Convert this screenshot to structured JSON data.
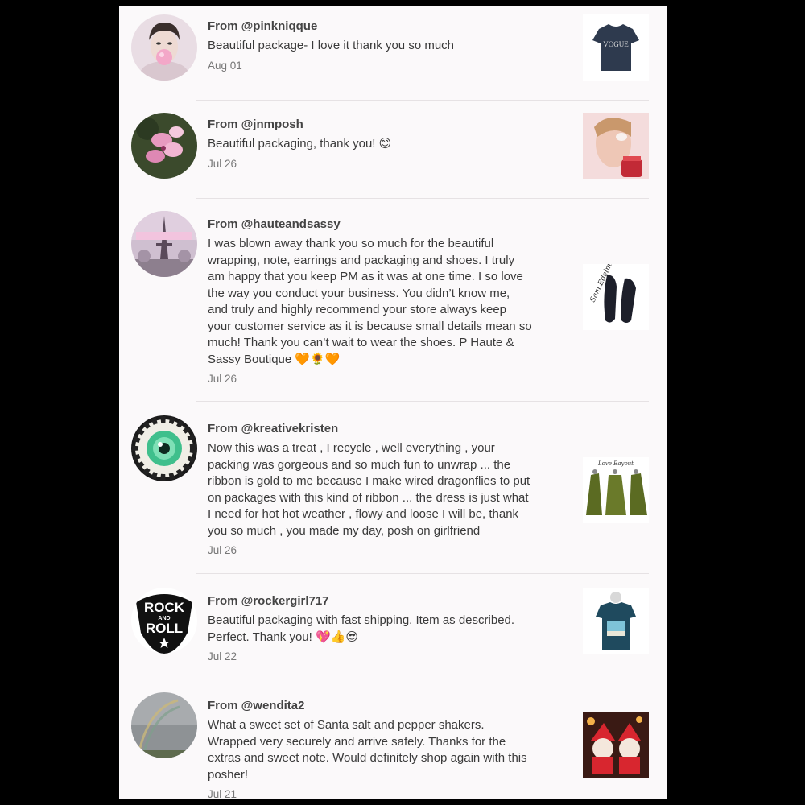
{
  "reviews": [
    {
      "from_prefix": "From",
      "username": "@pinkniqque",
      "message": "Beautiful package- I love it thank you so much",
      "date": "Aug 01",
      "avatar_icon": "avatar-woman-bubblegum",
      "item_icon": "tshirt-vogue"
    },
    {
      "from_prefix": "From",
      "username": "@jnmposh",
      "message": "Beautiful packaging, thank you! 😊",
      "date": "Jul 26",
      "avatar_icon": "avatar-pink-flowers",
      "item_icon": "skincare-model"
    },
    {
      "from_prefix": "From",
      "username": "@hauteandsassy",
      "message": "I was blown away thank you so much for the beautiful\nwrapping, note, earrings and packaging and shoes. I truly\nam happy that you keep PM as it was at one time. I so love\nthe way you conduct your business. You didn’t know me,\nand truly and highly recommend your store always keep\nyour customer service as it is because small details mean so\nmuch! Thank you can’t wait to wear the shoes. P Haute &\nSassy Boutique 🧡🌻🧡",
      "date": "Jul 26",
      "avatar_icon": "avatar-paris-eiffel",
      "item_icon": "black-pumps"
    },
    {
      "from_prefix": "From",
      "username": "@kreativekristen",
      "message": "Now this was a treat , I recycle , well everything , your\npacking was gorgeous and so much fun to unwrap ... the\nribbon is gold to me because I make wired dragonflies to put\non packages with this kind of ribbon ... the dress is just what\nI need for hot hot weather , flowy and loose I will be, thank\nyou so much , you made my day, posh on girlfriend",
      "date": "Jul 26",
      "avatar_icon": "avatar-green-eye",
      "item_icon": "green-dresses"
    },
    {
      "from_prefix": "From",
      "username": "@rockergirl717",
      "message": "Beautiful packaging with fast shipping. Item as described.\nPerfect. Thank you! 💖👍😎",
      "date": "Jul 22",
      "avatar_icon": "avatar-rock-and-roll",
      "avatar_text_top": "ROCK",
      "avatar_text_mid": "AND",
      "avatar_text_bottom": "ROLL",
      "item_icon": "teal-tshirt"
    },
    {
      "from_prefix": "From",
      "username": "@wendita2",
      "message": "What a sweet set of Santa salt and pepper shakers.\nWrapped very securely and arrive safely. Thanks for the\nextras and sweet note. Would definitely shop again with this\nposher!",
      "date": "Jul 21",
      "avatar_icon": "avatar-rainbow-sky",
      "item_icon": "santa-shakers"
    }
  ],
  "item_labels": {
    "tshirt_text": "VOGUE",
    "pumps_brand": "Sam Edelman",
    "dresses_brand": "Love Bayout"
  }
}
